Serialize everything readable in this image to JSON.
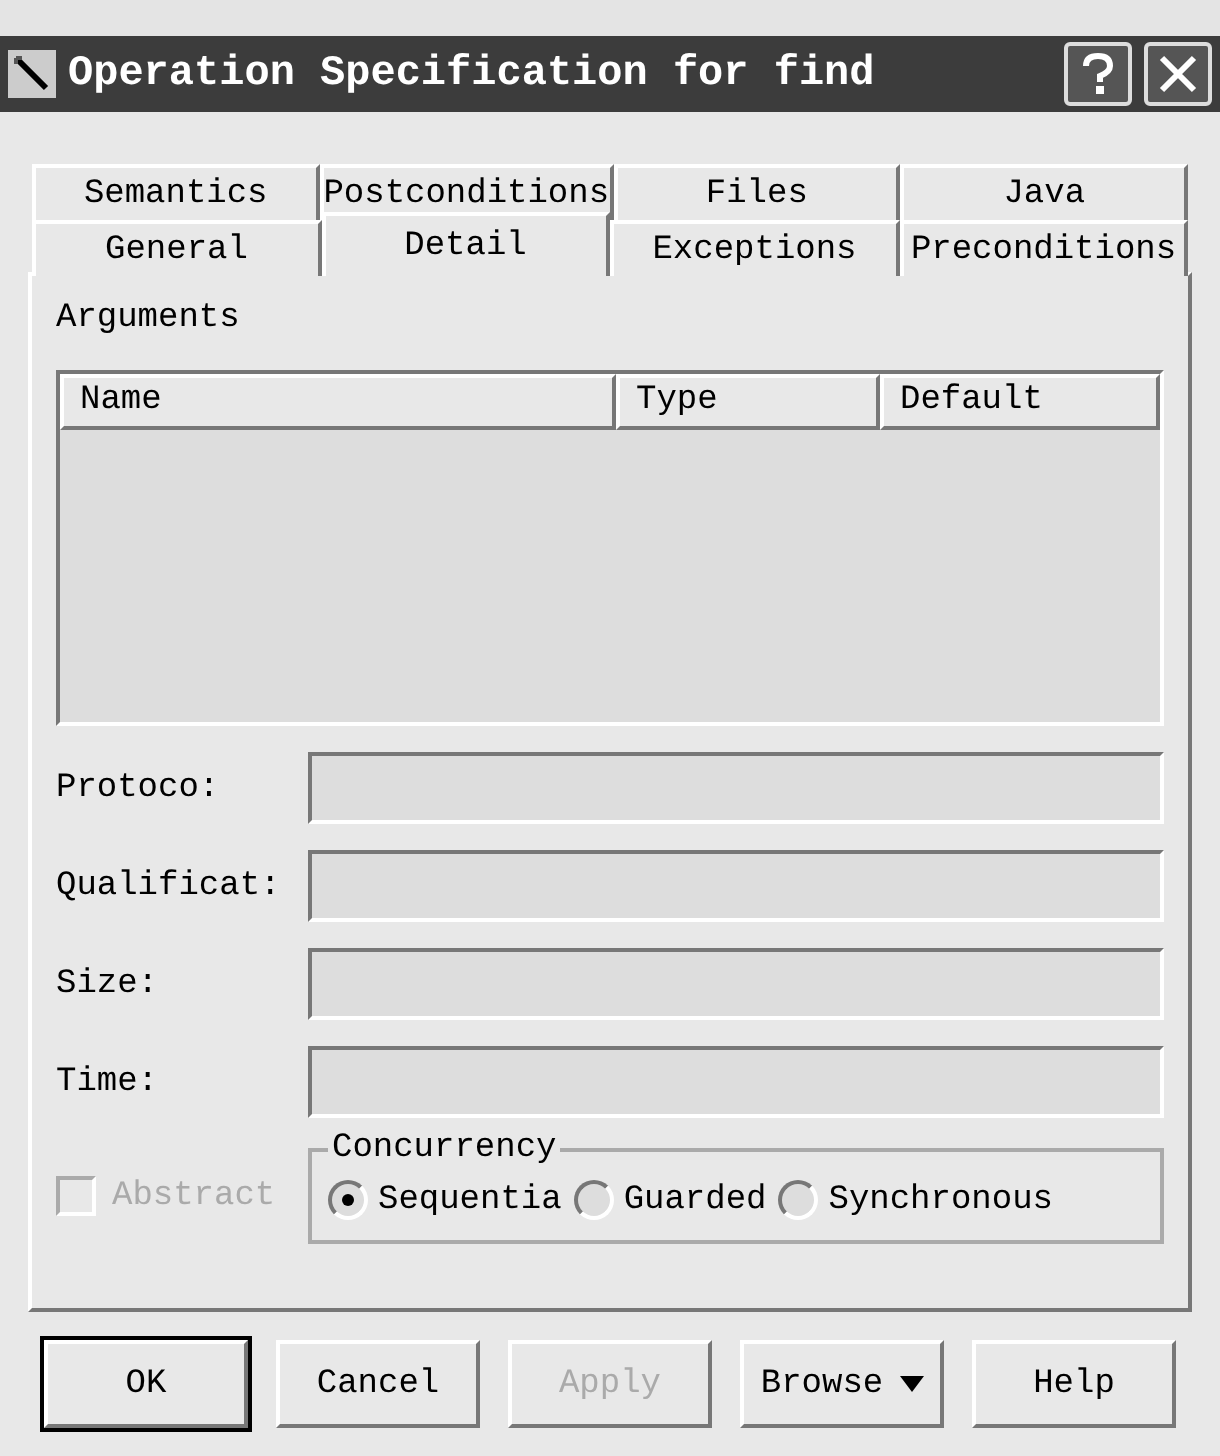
{
  "window": {
    "title": "Operation Specification for find"
  },
  "tab_rows": [
    [
      {
        "label": "Semantics",
        "selected": false
      },
      {
        "label": "Postconditions",
        "selected": false
      },
      {
        "label": "Files",
        "selected": false
      },
      {
        "label": "Java",
        "selected": false
      }
    ],
    [
      {
        "label": "General",
        "selected": false
      },
      {
        "label": "Detail",
        "selected": true
      },
      {
        "label": "Exceptions",
        "selected": false
      },
      {
        "label": "Preconditions",
        "selected": false
      }
    ]
  ],
  "arguments": {
    "label": "Arguments",
    "columns": [
      "Name",
      "Type",
      "Default"
    ]
  },
  "fields": [
    {
      "label": "Protoco:"
    },
    {
      "label": "Qualificat:"
    },
    {
      "label": "Size:"
    },
    {
      "label": "Time:"
    }
  ],
  "abstract": {
    "label": "Abstract",
    "checked": false,
    "disabled": true
  },
  "concurrency": {
    "label": "Concurrency",
    "options": [
      {
        "label": "Sequentia",
        "selected": true
      },
      {
        "label": "Guarded",
        "selected": false
      },
      {
        "label": "Synchronous",
        "selected": false
      }
    ]
  },
  "buttons": [
    {
      "label": "OK",
      "default": true,
      "disabled": false,
      "kind": "plain"
    },
    {
      "label": "Cancel",
      "default": false,
      "disabled": false,
      "kind": "plain"
    },
    {
      "label": "Apply",
      "default": false,
      "disabled": true,
      "kind": "plain"
    },
    {
      "label": "Browse",
      "default": false,
      "disabled": false,
      "kind": "menu"
    },
    {
      "label": "Help",
      "default": false,
      "disabled": false,
      "kind": "plain"
    }
  ]
}
